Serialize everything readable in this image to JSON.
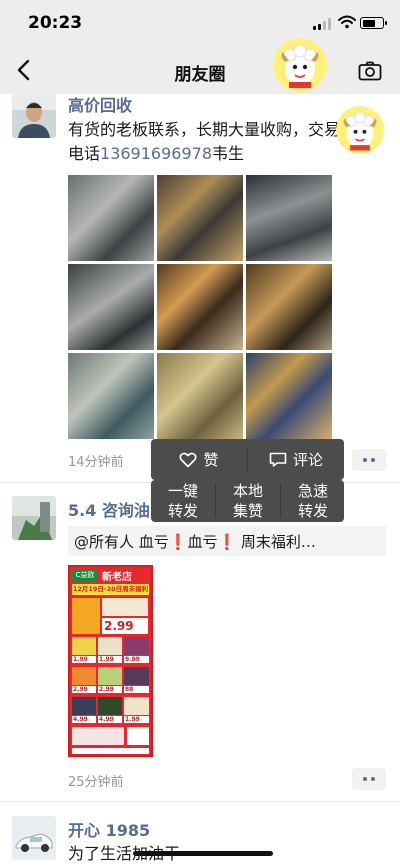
{
  "status_bar": {
    "time": "20:23",
    "battery_level": 0.7,
    "signal_bars": 2
  },
  "nav": {
    "title": "朋友圈",
    "back_icon": "chevron-left-icon",
    "camera_icon": "camera-icon"
  },
  "posts": [
    {
      "username": "高价回收",
      "text_before": "有货的老板联系，长期大量收购，交易电话",
      "phone": "13691696978",
      "text_after": "韦生",
      "time_ago": "14分钟前",
      "image_count": 9
    },
    {
      "username": "5.4 咨询油",
      "share_text": "@所有人 血亏❗血亏❗ 周末福利…",
      "poster": {
        "brand": "C益欧",
        "store": "新老店",
        "band": "12月19日-20日周末福利",
        "price": "2.99",
        "item_prices": [
          "1.99",
          "1.99",
          "9.99",
          "2.99",
          "2.99",
          "88",
          "4.99",
          "4.99",
          "1.99"
        ]
      },
      "time_ago": "25分钟前"
    },
    {
      "username": "开心 1985",
      "text": "为了生活加油干"
    }
  ],
  "popup": {
    "like_label": "赞",
    "comment_label": "评论",
    "like_icon": "heart-icon",
    "comment_icon": "comment-icon"
  },
  "actions": [
    {
      "line1": "一键",
      "line2": "转发"
    },
    {
      "line1": "本地",
      "line2": "集赞"
    },
    {
      "line1": "急速",
      "line2": "转发"
    }
  ],
  "colors": {
    "link": "#576b95",
    "popup_bg": "#4c4c4c",
    "nav_bg": "#ededed",
    "poster_red": "#e8272c"
  }
}
